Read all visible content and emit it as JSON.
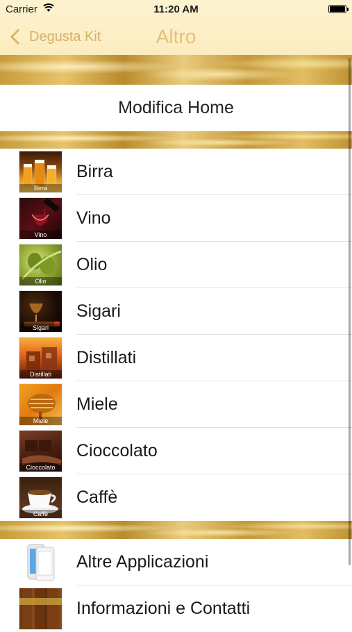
{
  "status_bar": {
    "carrier": "Carrier",
    "time": "11:20 AM"
  },
  "nav": {
    "back_label": "Degusta Kit",
    "title": "Altro"
  },
  "home_cell": {
    "label": "Modifica Home"
  },
  "categories": [
    {
      "label": "Birra",
      "caption": "Birra",
      "icon": "beer-icon"
    },
    {
      "label": "Vino",
      "caption": "Vino",
      "icon": "wine-icon"
    },
    {
      "label": "Olio",
      "caption": "Olio",
      "icon": "olive-oil-icon"
    },
    {
      "label": "Sigari",
      "caption": "Sigari",
      "icon": "cigar-icon"
    },
    {
      "label": "Distillati",
      "caption": "Distillati",
      "icon": "spirits-icon"
    },
    {
      "label": "Miele",
      "caption": "Miele",
      "icon": "honey-icon"
    },
    {
      "label": "Cioccolato",
      "caption": "Cioccolato",
      "icon": "chocolate-icon"
    },
    {
      "label": "Caffè",
      "caption": "Caffè",
      "icon": "coffee-icon"
    }
  ],
  "extras": [
    {
      "label": "Altre Applicazioni",
      "icon": "phone-icon"
    },
    {
      "label": "Informazioni e Contatti",
      "icon": "info-cigars-icon"
    }
  ],
  "colors": {
    "nav_tint": "#d3b26a",
    "nav_background": "#fbecc0",
    "gold_band": "#c79b3a"
  }
}
